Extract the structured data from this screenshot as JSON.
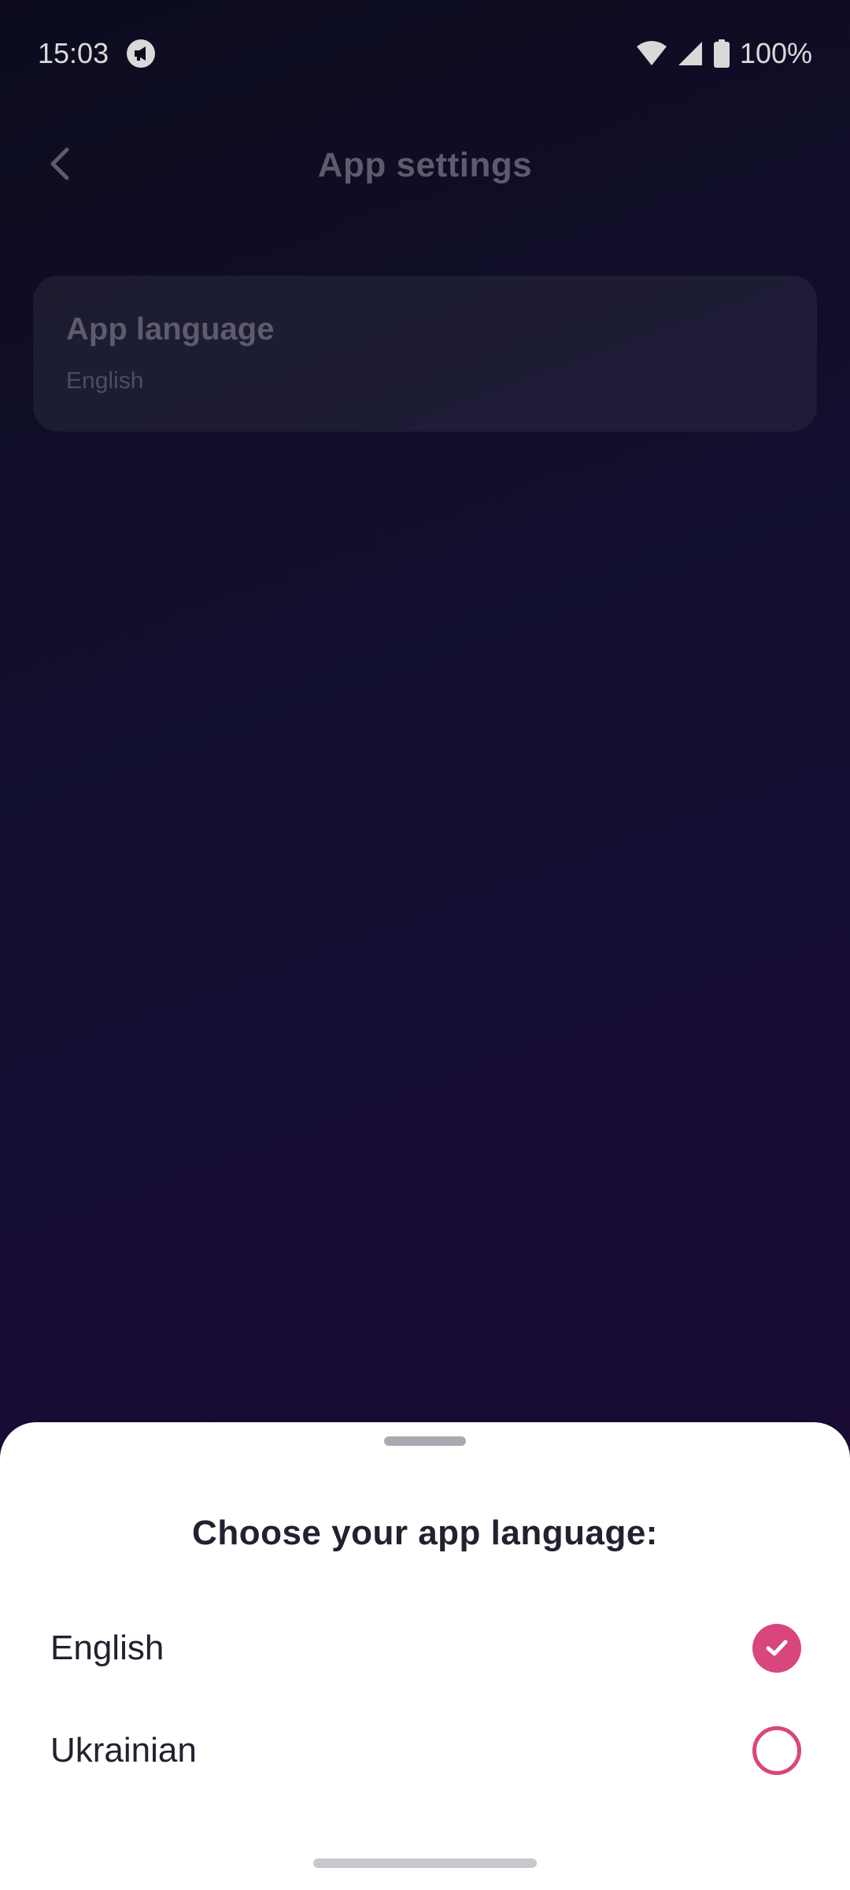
{
  "status_bar": {
    "time": "15:03",
    "battery": "100%",
    "icons": [
      "notification-icon",
      "wifi-icon",
      "signal-icon",
      "battery-icon"
    ]
  },
  "header": {
    "title": "App settings",
    "back_icon": "chevron-left-icon"
  },
  "settings": {
    "language_title": "App language",
    "language_value": "English"
  },
  "sheet": {
    "title": "Choose your app language:",
    "options": [
      {
        "label": "English",
        "selected": true
      },
      {
        "label": "Ukrainian",
        "selected": false
      }
    ]
  },
  "colors": {
    "accent": "#d9467e",
    "background_start": "#0f0f24",
    "background_end": "#220b3b",
    "sheet": "#ffffff"
  }
}
